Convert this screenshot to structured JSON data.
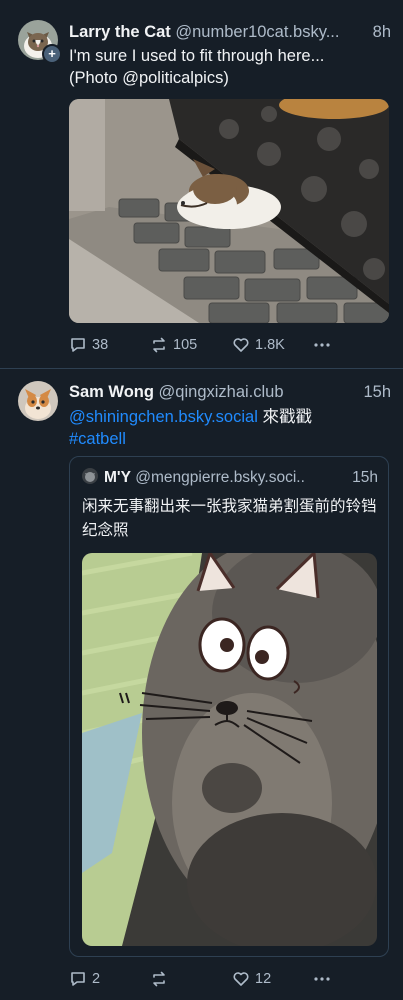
{
  "posts": [
    {
      "author_name": "Larry the Cat",
      "author_handle": "@number10cat.bsky...",
      "time": "8h",
      "text_line1": "I'm sure I used to fit through here...",
      "text_line2": "(Photo @politicalpics)",
      "replies": "38",
      "reposts": "105",
      "likes": "1.8K"
    },
    {
      "author_name": "Sam Wong",
      "author_handle": "@qingxizhai.club",
      "time": "15h",
      "mention": "@shiningchen.bsky.social",
      "text_after_mention": " 來戳戳",
      "hashtag": "#catbell",
      "quote": {
        "author_name": "M'Y",
        "author_handle": "@mengpierre.bsky.soci..",
        "time": "15h",
        "text": "闲来无事翻出来一张我家猫弟割蛋前的铃铛纪念照"
      },
      "replies": "2",
      "reposts": "",
      "likes": "12"
    }
  ],
  "icons": {
    "reply": "speech-bubble-icon",
    "repost": "repost-arrows-icon",
    "like": "heart-icon",
    "more": "ellipsis-icon"
  },
  "colors": {
    "background": "#161e27",
    "link": "#208bfe",
    "muted": "#aebbc9",
    "divider": "#2e4052"
  }
}
